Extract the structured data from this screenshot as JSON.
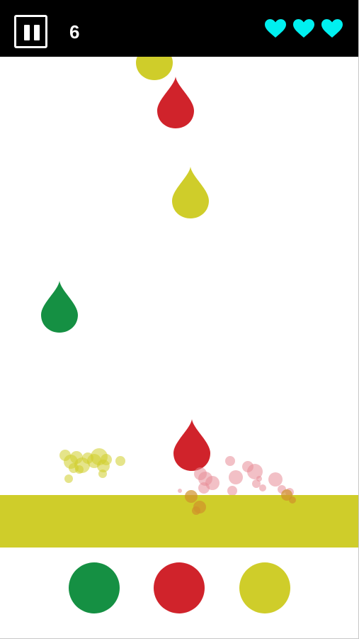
{
  "hud": {
    "pause_icon": "pause-icon",
    "score": "6",
    "lives": 3,
    "life_icon": "heart-icon",
    "life_color": "#00F0F0"
  },
  "colors": {
    "green": "#159043",
    "red": "#D0232B",
    "yellow": "#CFCD2A"
  },
  "active_band_color": "yellow",
  "color_buttons": [
    {
      "name": "green-color-button",
      "color": "green"
    },
    {
      "name": "red-color-button",
      "color": "red"
    },
    {
      "name": "yellow-color-button",
      "color": "yellow"
    }
  ],
  "falling_drops": [
    {
      "name": "drop-yellow-top",
      "color": "yellow"
    },
    {
      "name": "drop-red-1",
      "color": "red"
    },
    {
      "name": "drop-yellow-2",
      "color": "yellow"
    },
    {
      "name": "drop-green-1",
      "color": "green"
    },
    {
      "name": "drop-red-2",
      "color": "red"
    }
  ]
}
